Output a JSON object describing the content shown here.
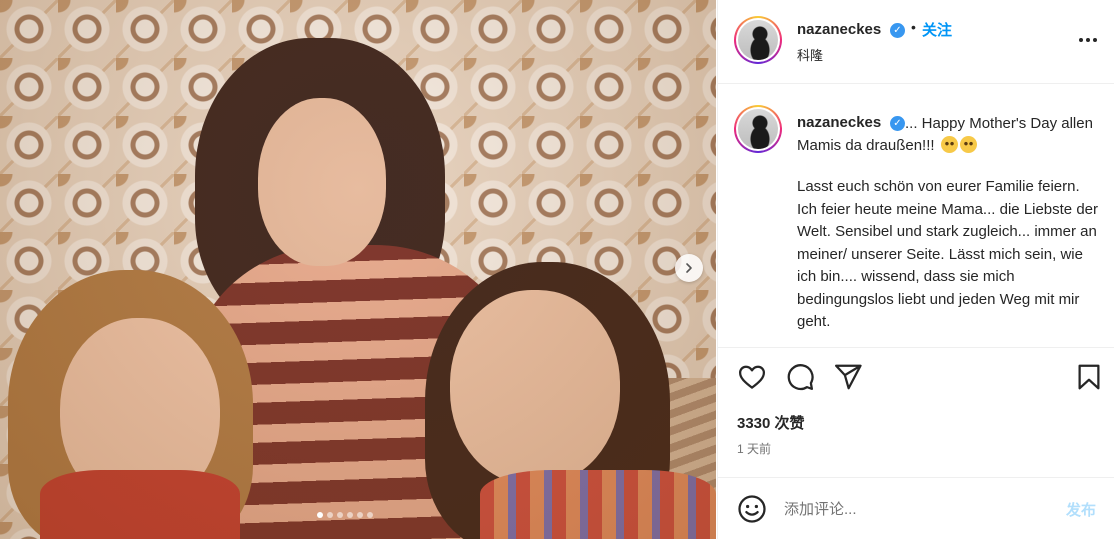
{
  "post": {
    "username": "nazaneckes",
    "verified_mark": "✓",
    "separator": "•",
    "follow_label": "关注",
    "location": "科隆",
    "caption_first": "... Happy Mother's Day allen Mamis da draußen!!!",
    "caption_body": "Lasst euch schön von eurer Familie feiern. Ich feier heute meine Mama... die Liebste der Welt. Sensibel und stark zugleich... immer an meiner/ unserer Seite. Lässt mich sein, wie ich bin.... wissend, dass sie mich bedingungslos liebt und jeden Weg mit mir geht.",
    "caption_emojis": [
      "smiling-face-with-tear",
      "smiling-face-with-tear"
    ],
    "likes": "3330 次赞",
    "time_ago": "1 天前",
    "comment_placeholder": "添加评论...",
    "post_label": "发布"
  },
  "carousel": {
    "total_slides": 6,
    "active_index": 0
  },
  "icons": {
    "more": "more-options-icon",
    "like": "heart-icon",
    "comment": "comment-icon",
    "share": "send-icon",
    "save": "bookmark-icon",
    "emoji": "emoji-icon",
    "next": "chevron-right-icon"
  },
  "colors": {
    "follow": "#0095f6",
    "verified": "#3897f0",
    "post_disabled": "#b2dffc"
  }
}
